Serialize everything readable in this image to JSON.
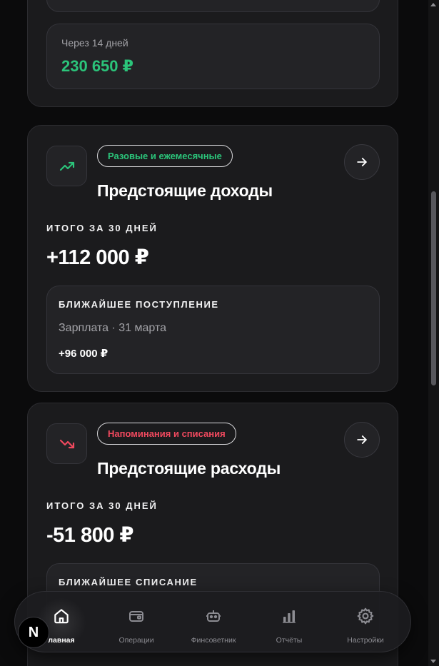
{
  "forecast": {
    "label": "Через 14 дней",
    "value": "230 650 ₽"
  },
  "income": {
    "badge": "Разовые и ежемесячные",
    "title": "Предстоящие доходы",
    "total_label": "ИТОГО ЗА 30 ДНЕЙ",
    "total_value": "+112 000 ₽",
    "next_label": "БЛИЖАЙШЕЕ ПОСТУПЛЕНИЕ",
    "next_desc": "Зарплата · 31 марта",
    "next_amount": "+96 000 ₽",
    "icon": "trending-up-icon",
    "accent": "#2bc47a"
  },
  "expense": {
    "badge": "Напоминания и списания",
    "title": "Предстоящие расходы",
    "total_label": "ИТОГО ЗА 30 ДНЕЙ",
    "total_value": "-51 800 ₽",
    "next_label": "БЛИЖАЙШЕЕ СПИСАНИЕ",
    "icon": "trending-down-icon",
    "accent": "#f0495e"
  },
  "nav": {
    "items": [
      {
        "label": "лавная",
        "icon": "home-icon",
        "active": true
      },
      {
        "label": "Операции",
        "icon": "wallet-icon",
        "active": false
      },
      {
        "label": "Финсоветник",
        "icon": "robot-icon",
        "active": false
      },
      {
        "label": "Отчёты",
        "icon": "bar-chart-icon",
        "active": false
      },
      {
        "label": "Настройки",
        "icon": "gear-icon",
        "active": false
      }
    ],
    "logo": "N"
  }
}
